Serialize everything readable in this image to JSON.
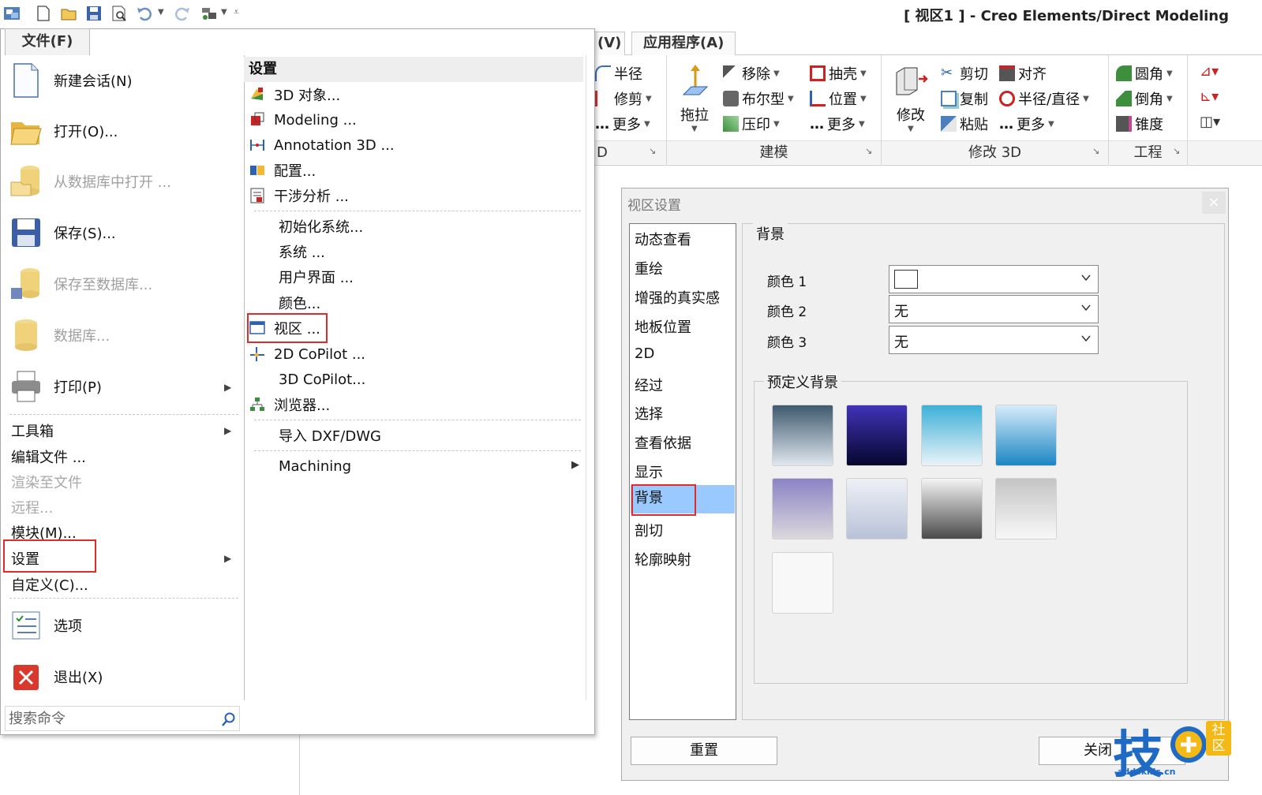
{
  "window": {
    "title": "[ 视区1 ] - Creo Elements/Direct Modeling"
  },
  "quick_access": [
    "app-icon",
    "new-icon",
    "open-icon",
    "save-icon",
    "preview-icon",
    "undo-icon",
    "redo-icon",
    "filter-icon"
  ],
  "ribbon": {
    "tabs": [
      {
        "label": "(V)"
      },
      {
        "label": "应用程序(A)"
      }
    ],
    "group_partial": {
      "label": "D"
    },
    "col1": [
      "半径",
      "修剪",
      "更多"
    ],
    "pull": "拖拉",
    "model_col1": [
      "移除",
      "布尔型",
      "压印"
    ],
    "model_col2": [
      "抽壳",
      "位置",
      "更多"
    ],
    "group_modeling": "建模",
    "modify": "修改",
    "mod_col1": [
      "剪切",
      "复制",
      "粘贴"
    ],
    "mod_col2": [
      "对齐",
      "半径/直径",
      "更多"
    ],
    "group_modify3d": "修改 3D",
    "eng_col": [
      "圆角",
      "倒角",
      "锥度"
    ],
    "group_engineering": "工程"
  },
  "file_menu": {
    "tab_label": "文件(F)",
    "big_items": [
      {
        "label": "新建会话(N)",
        "disabled": false
      },
      {
        "label": "打开(O)...",
        "disabled": false
      },
      {
        "label": "从数据库中打开 ...",
        "disabled": true
      },
      {
        "label": "保存(S)...",
        "disabled": false
      },
      {
        "label": "保存至数据库...",
        "disabled": true
      },
      {
        "label": "数据库...",
        "disabled": true
      },
      {
        "label": "打印(P)",
        "disabled": false
      }
    ],
    "small_items": [
      {
        "label": "工具箱",
        "disabled": false
      },
      {
        "label": "编辑文件 ...",
        "disabled": false
      },
      {
        "label": "渲染至文件",
        "disabled": true
      },
      {
        "label": "远程...",
        "disabled": true
      },
      {
        "label": "模块(M)...",
        "disabled": false
      },
      {
        "label": "设置",
        "disabled": false
      },
      {
        "label": "自定义(C)...",
        "disabled": false
      }
    ],
    "bottom_items": [
      {
        "label": "选项"
      },
      {
        "label": "退出(X)"
      }
    ],
    "search": {
      "placeholder": "搜索命令"
    }
  },
  "settings_submenu": {
    "title": "设置",
    "group1": [
      "3D 对象...",
      "Modeling ...",
      "Annotation 3D ...",
      "配置...",
      "干涉分析 ..."
    ],
    "group2": [
      "初始化系统...",
      "系统 ...",
      "用户界面 ...",
      "颜色...",
      "视区 ...",
      "2D CoPilot ...",
      "3D CoPilot...",
      "浏览器..."
    ],
    "group3": [
      "导入 DXF/DWG"
    ],
    "group4": [
      "Machining"
    ]
  },
  "dialog": {
    "title": "视区设置",
    "close": "×",
    "list": [
      "动态查看",
      "重绘",
      "增强的真实感",
      "地板位置",
      "2D",
      "经过",
      "选择",
      "查看依据",
      "显示",
      "背景",
      "剖切",
      "轮廓映射"
    ],
    "selected": "背景",
    "panel_title": "背景",
    "color_labels": [
      "颜色 1",
      "颜色 2",
      "颜色 3"
    ],
    "color_values": [
      "",
      "无",
      "无"
    ],
    "predefined_title": "预定义背景",
    "reset": "重置",
    "close_button": "关闭"
  },
  "watermark": {
    "main": "技",
    "badge": "社区",
    "url": "addskills.cn"
  },
  "colors": {
    "highlight": "#99c9ff",
    "annotation_red": "#e02b2b",
    "menu_border": "#a9a9a9"
  }
}
